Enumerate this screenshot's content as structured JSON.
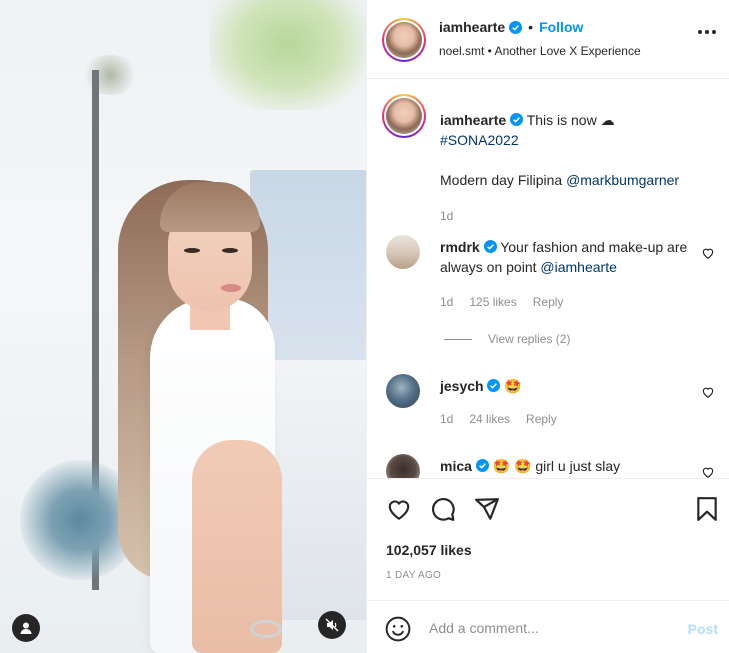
{
  "post": {
    "username": "iamhearte",
    "follow_label": "Follow",
    "separator": "•",
    "subtitle": "noel.smt • Another Love X Experience"
  },
  "caption": {
    "username": "iamhearte",
    "text": "This is now ☁",
    "hashtag": "#SONA2022",
    "line2": "Modern day Filipina ",
    "mention": "@markbumgarner",
    "time": "1d"
  },
  "comments": [
    {
      "username": "rmdrk",
      "text": "Your fashion and make-up are always on point ",
      "mention": "@iamhearte",
      "time": "1d",
      "likes": "125 likes",
      "reply": "Reply"
    },
    {
      "username": "jesych",
      "text": "🤩",
      "time": "1d",
      "likes": "24 likes",
      "reply": "Reply"
    },
    {
      "username": "mica",
      "text": "🤩 🤩 girl u just slay"
    }
  ],
  "view_replies": "View replies (2)",
  "likes_count": "102,057 likes",
  "time_ago": "1 DAY AGO",
  "comment_box": {
    "placeholder": "Add a comment...",
    "post_label": "Post"
  },
  "colors": {
    "accent": "#0095f6",
    "link": "#00376b",
    "muted": "#8e8e8e",
    "post_disabled": "#b2dffc"
  },
  "icons": [
    "user-tag-icon",
    "mute-icon",
    "verified-icon",
    "more-icon",
    "heart-icon",
    "comment-icon",
    "share-icon",
    "bookmark-icon",
    "emoji-icon"
  ]
}
